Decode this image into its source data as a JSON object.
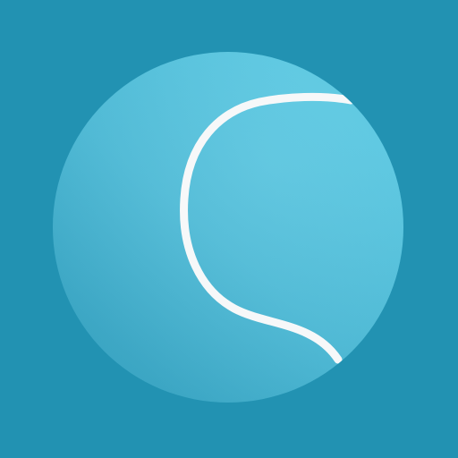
{
  "colors": {
    "background": "#2292b2",
    "ball_light": "#5ac9e3",
    "ball_mid": "#4fbcd8",
    "ball_dark": "#3eaac8",
    "seam": "#f6f8f9"
  },
  "icon": {
    "name": "tennis-ball-icon"
  }
}
